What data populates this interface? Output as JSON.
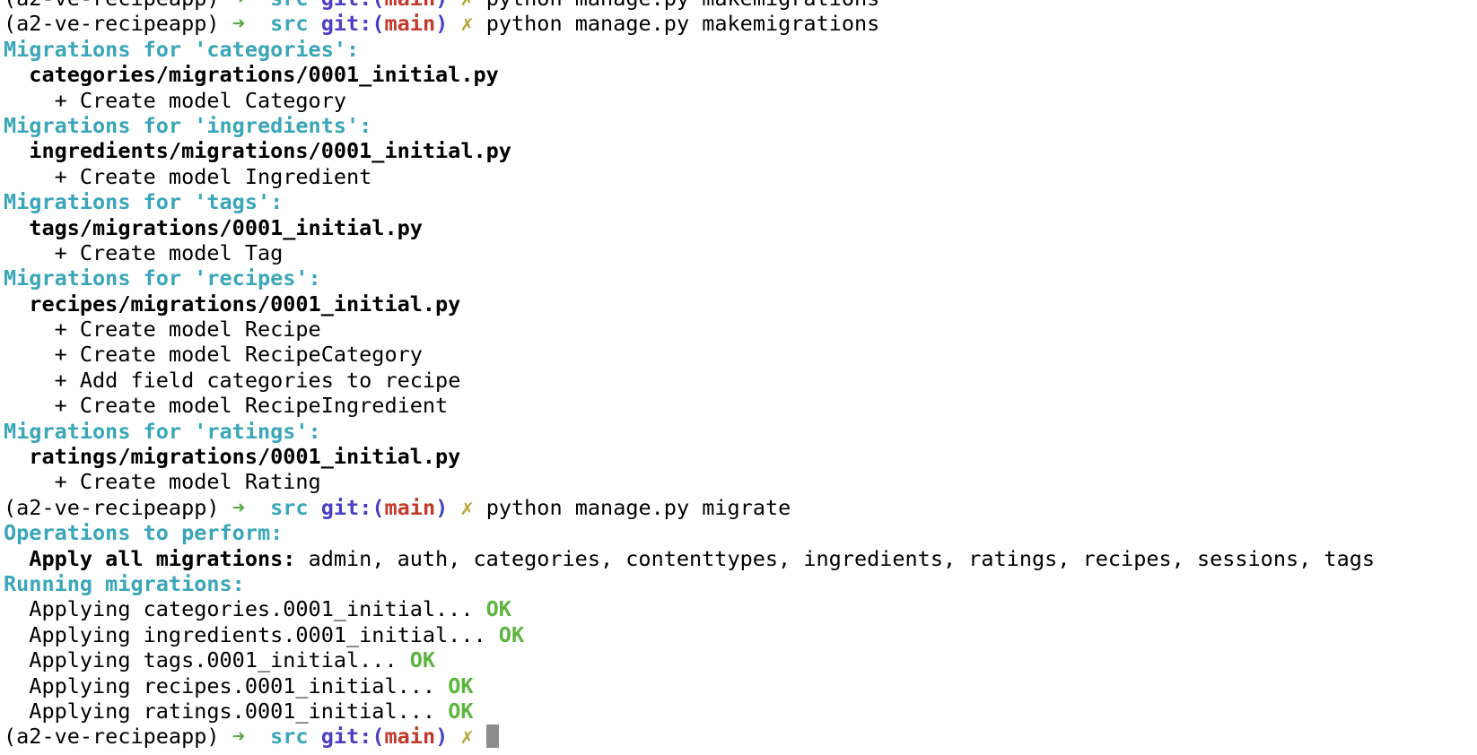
{
  "prompt": {
    "venv": "(a2-ve-recipeapp)",
    "arrow": "➜",
    "dir": "src",
    "git_label": "git:(",
    "branch": "main",
    "git_close": ")",
    "dirty_mark": "✗"
  },
  "partial_line": "python manage.py makemigrations",
  "commands": {
    "makemigrations": "python manage.py makemigrations",
    "migrate": "python manage.py migrate"
  },
  "makemigrations_output": [
    {
      "heading": "Migrations for 'categories':",
      "file": "categories/migrations/0001_initial.py",
      "ops": [
        "+ Create model Category"
      ]
    },
    {
      "heading": "Migrations for 'ingredients':",
      "file": "ingredients/migrations/0001_initial.py",
      "ops": [
        "+ Create model Ingredient"
      ]
    },
    {
      "heading": "Migrations for 'tags':",
      "file": "tags/migrations/0001_initial.py",
      "ops": [
        "+ Create model Tag"
      ]
    },
    {
      "heading": "Migrations for 'recipes':",
      "file": "recipes/migrations/0001_initial.py",
      "ops": [
        "+ Create model Recipe",
        "+ Create model RecipeCategory",
        "+ Add field categories to recipe",
        "+ Create model RecipeIngredient"
      ]
    },
    {
      "heading": "Migrations for 'ratings':",
      "file": "ratings/migrations/0001_initial.py",
      "ops": [
        "+ Create model Rating"
      ]
    }
  ],
  "migrate_output": {
    "ops_heading": "Operations to perform:",
    "apply_label": "Apply all migrations:",
    "apply_apps": " admin, auth, categories, contenttypes, ingredients, ratings, recipes, sessions, tags",
    "running_heading": "Running migrations:",
    "applying": [
      {
        "text": "Applying categories.0001_initial...",
        "status": "OK"
      },
      {
        "text": "Applying ingredients.0001_initial...",
        "status": "OK"
      },
      {
        "text": "Applying tags.0001_initial...",
        "status": "OK"
      },
      {
        "text": "Applying recipes.0001_initial...",
        "status": "OK"
      },
      {
        "text": "Applying ratings.0001_initial...",
        "status": "OK"
      }
    ]
  },
  "colors": {
    "arrow": "#5aa846",
    "dir": "#3aa6b9",
    "git": "#4b3fc4",
    "branch": "#c23a2b",
    "dirty_mark": "#b6a436",
    "heading": "#3aa6b9",
    "ok": "#5bb53f"
  }
}
